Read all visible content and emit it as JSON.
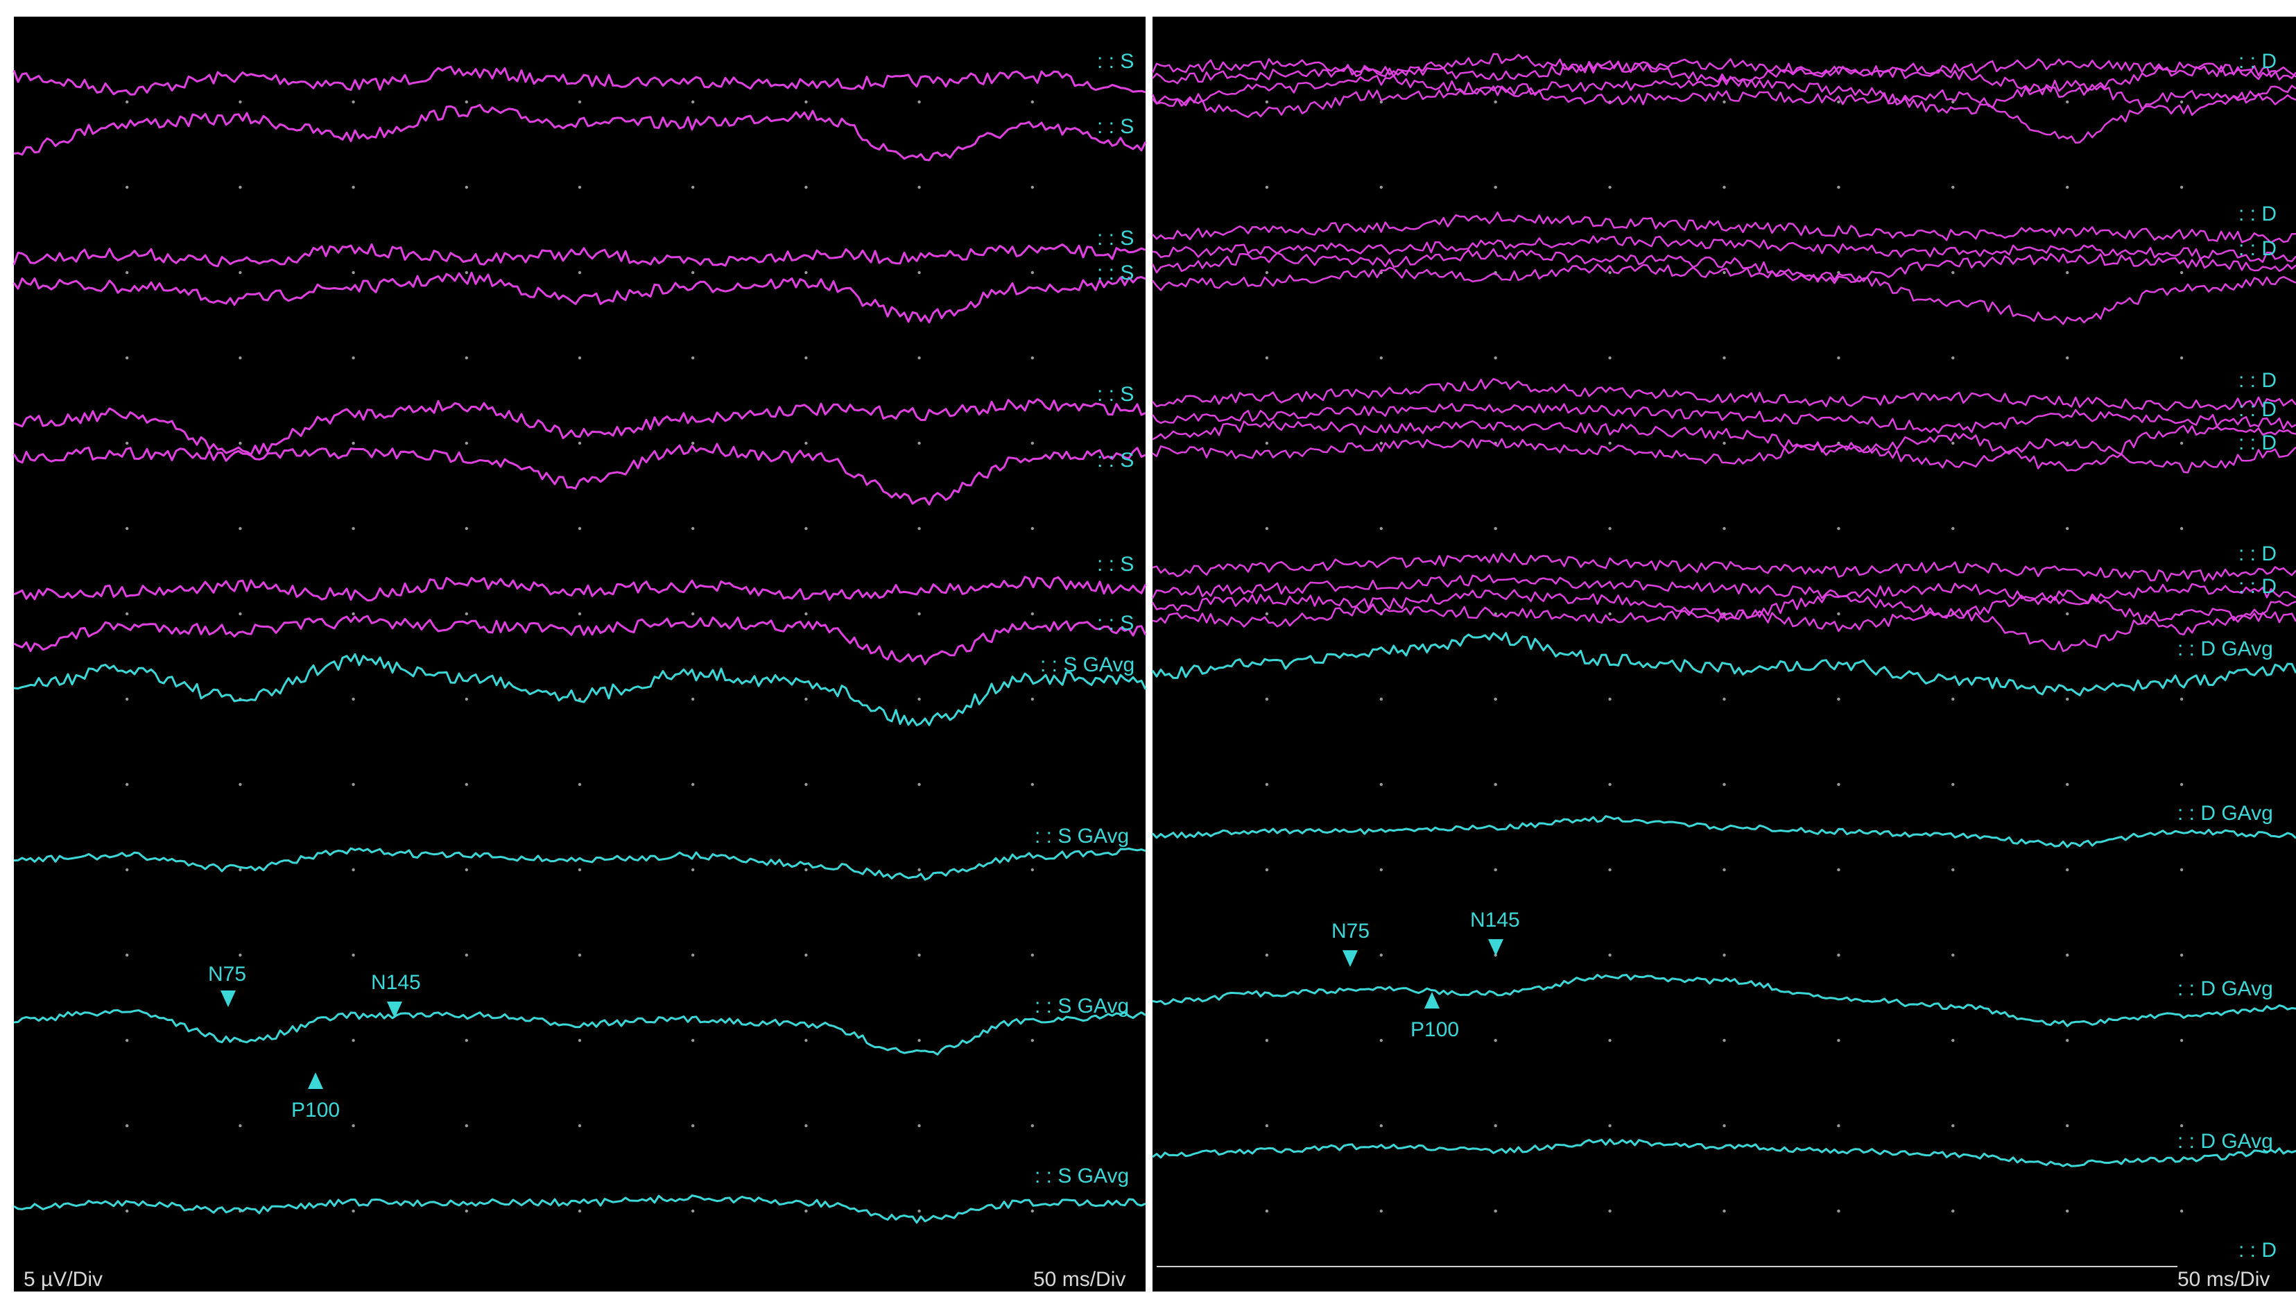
{
  "colors": {
    "background": "#000000",
    "frame": "#ffffff",
    "grid_dot": "#9a9a9a",
    "raw_trace": "#e040e0",
    "avg_trace": "#3cd8d8",
    "label": "#3cd8d8",
    "scale_text": "#d9d9d9"
  },
  "left_panel": {
    "scale_y": "5 µV/Div",
    "scale_x": "50 ms/Div",
    "raw_labels": [
      ": : S",
      ": : S",
      ": : S",
      ": : S",
      ": : S",
      ": : S",
      ": : S",
      ": : S"
    ],
    "avg_labels": [
      ": : S GAvg",
      ": : S GAvg",
      ": : S GAvg",
      ": : S GAvg"
    ],
    "peaks": {
      "n75": "N75",
      "p100": "P100",
      "n145": "N145"
    }
  },
  "right_panel": {
    "scale_x": "50 ms/Div",
    "raw_labels": [
      ": : D",
      ": : D",
      ": : D",
      ": : D",
      ": : D",
      ": : D",
      ": : D",
      ": : D"
    ],
    "avg_labels": [
      ": : D GAvg",
      ": : D GAvg",
      ": : D GAvg",
      ": : D GAvg"
    ],
    "extra_label": ": : D",
    "peaks": {
      "n75": "N75",
      "p100": "P100",
      "n145": "N145"
    }
  },
  "chart_data": [
    {
      "type": "line",
      "panel": "left",
      "xlabel": "50 ms/Div",
      "ylabel": "5 µV/Div",
      "grid": true,
      "x_divisions": 10,
      "y_divisions": 14,
      "series": [
        {
          "name": "S GAvg 1",
          "values": [
            0,
            0.4,
            -0.3,
            0.6,
            0.2,
            -0.2,
            0.3,
            0.1,
            -0.8,
            0.2,
            0.1
          ]
        },
        {
          "name": "S GAvg 2",
          "values": [
            0,
            0.1,
            -0.2,
            0.2,
            0.1,
            0,
            0.1,
            -0.1,
            -0.4,
            0.1,
            0.2
          ]
        },
        {
          "name": "S GAvg 3",
          "values": [
            0,
            0.2,
            -0.5,
            0.1,
            0.1,
            -0.1,
            0,
            -0.1,
            -0.8,
            0,
            0.1
          ]
        },
        {
          "name": "S GAvg 4",
          "values": [
            0,
            0.1,
            -0.1,
            0.1,
            0.1,
            0.1,
            0.2,
            0.1,
            -0.3,
            0.1,
            0.1
          ]
        }
      ],
      "annotations": [
        {
          "label": "N75",
          "x_div": 1.9
        },
        {
          "label": "P100",
          "x_div": 2.65
        },
        {
          "label": "N145",
          "x_div": 3.4
        }
      ]
    },
    {
      "type": "line",
      "panel": "right",
      "xlabel": "50 ms/Div",
      "grid": true,
      "x_divisions": 10,
      "y_divisions": 14,
      "series": [
        {
          "name": "D GAvg 1",
          "values": [
            0,
            0.2,
            0.5,
            0.8,
            0.3,
            0.1,
            0.2,
            -0.2,
            -0.4,
            -0.2,
            0.1
          ]
        },
        {
          "name": "D GAvg 2",
          "values": [
            0,
            0.1,
            0.1,
            0.2,
            0.4,
            0.2,
            0.1,
            0,
            -0.2,
            0.1,
            0
          ]
        },
        {
          "name": "D GAvg 3",
          "values": [
            0,
            0.2,
            0.3,
            0.2,
            0.6,
            0.5,
            0.1,
            -0.1,
            -0.5,
            -0.3,
            -0.1
          ]
        },
        {
          "name": "D GAvg 4",
          "values": [
            0,
            0.1,
            0.2,
            0.1,
            0.3,
            0.2,
            0.1,
            0,
            -0.2,
            -0.1,
            0.1
          ]
        }
      ],
      "annotations": [
        {
          "label": "N75",
          "x_div": 1.7
        },
        {
          "label": "P100",
          "x_div": 2.4
        },
        {
          "label": "N145",
          "x_div": 3.0
        }
      ]
    }
  ]
}
